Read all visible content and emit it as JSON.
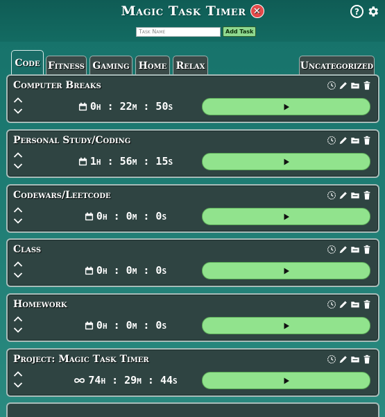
{
  "header": {
    "title": "Magic Task Timer",
    "close_icon": "close-circle-icon",
    "help_icon": "help-icon",
    "settings_icon": "gear-icon",
    "task_input_placeholder": "Task Name",
    "add_button_label": "Add Task"
  },
  "tabs": [
    {
      "label": "Code",
      "active": true
    },
    {
      "label": "Fitness",
      "active": false
    },
    {
      "label": "Gaming",
      "active": false
    },
    {
      "label": "Home",
      "active": false
    },
    {
      "label": "Relax",
      "active": false
    },
    {
      "label": "Uncategorized",
      "active": false
    }
  ],
  "tasks": [
    {
      "title": "Computer Breaks",
      "timer_icon": "calendar-icon",
      "hours": "0",
      "minutes": "22",
      "seconds": "50"
    },
    {
      "title": "Personal Study/Coding",
      "timer_icon": "calendar-icon",
      "hours": "1",
      "minutes": "56",
      "seconds": "15"
    },
    {
      "title": "Codewars/Leetcode",
      "timer_icon": "calendar-icon",
      "hours": "0",
      "minutes": "0",
      "seconds": "0"
    },
    {
      "title": "Class",
      "timer_icon": "calendar-icon",
      "hours": "0",
      "minutes": "0",
      "seconds": "0"
    },
    {
      "title": "Homework",
      "timer_icon": "calendar-icon",
      "hours": "0",
      "minutes": "0",
      "seconds": "0"
    },
    {
      "title": "Project: Magic Task Timer",
      "timer_icon": "infinity-icon",
      "hours": "74",
      "minutes": "29",
      "seconds": "44"
    }
  ],
  "colors": {
    "background": "#136b62",
    "card": "#2f4442",
    "play_button": "#91e38d",
    "close_button": "#e34a4a"
  }
}
